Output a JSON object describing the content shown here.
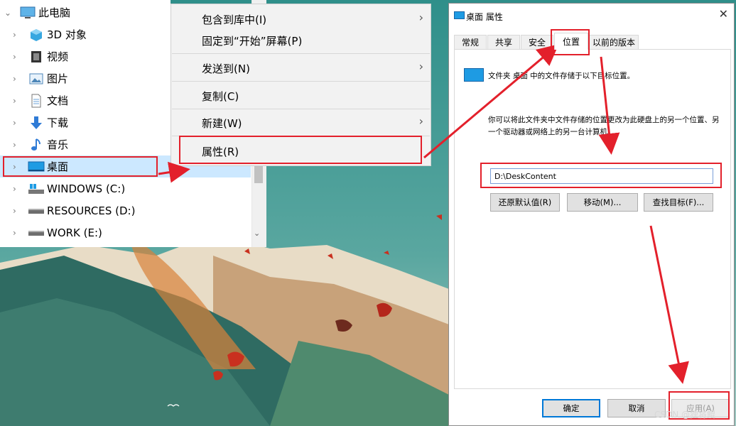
{
  "explorer": {
    "tree_items": [
      {
        "label": "此电脑",
        "icon": "monitor-icon"
      },
      {
        "label": "3D 对象",
        "icon": "cube-icon"
      },
      {
        "label": "视频",
        "icon": "film-icon"
      },
      {
        "label": "图片",
        "icon": "picture-icon"
      },
      {
        "label": "文档",
        "icon": "document-icon"
      },
      {
        "label": "下载",
        "icon": "download-arrow-icon"
      },
      {
        "label": "音乐",
        "icon": "music-note-icon"
      },
      {
        "label": "桌面",
        "icon": "desktop-icon"
      },
      {
        "label": "WINDOWS (C:)",
        "icon": "windows-drive-icon"
      },
      {
        "label": "RESOURCES (D:)",
        "icon": "drive-icon"
      },
      {
        "label": "WORK (E:)",
        "icon": "drive-icon"
      }
    ],
    "selected": "桌面"
  },
  "context_menu": {
    "items": [
      {
        "label": "包含到库中(I)",
        "submenu": true
      },
      {
        "label": "固定到“开始”屏幕(P)",
        "submenu": false
      },
      {
        "label": "发送到(N)",
        "submenu": true
      },
      {
        "label": "复制(C)",
        "submenu": false
      },
      {
        "label": "新建(W)",
        "submenu": true
      },
      {
        "label": "属性(R)",
        "submenu": false
      }
    ]
  },
  "dialog": {
    "title": "桌面 属性",
    "close_glyph": "✕",
    "tabs": [
      "常规",
      "共享",
      "安全",
      "位置",
      "以前的版本"
    ],
    "active_tab": "位置",
    "description_1": "文件夹 桌面 中的文件存储于以下目标位置。",
    "description_2": "你可以将此文件夹中文件存储的位置更改为此硬盘上的另一个位置、另一个驱动器或网络上的另一台计算机。",
    "location_value": "D:\\DeskContent",
    "buttons": {
      "restore": "还原默认值(R)",
      "move": "移动(M)...",
      "find_target": "查找目标(F)...",
      "ok": "确定",
      "cancel": "取消",
      "apply": "应用(A)"
    }
  },
  "watermark": "CSDN @狸将鲲",
  "colors": {
    "accent": "#0078d7",
    "annotation_red": "#e3202b",
    "selection": "#cce8ff"
  }
}
